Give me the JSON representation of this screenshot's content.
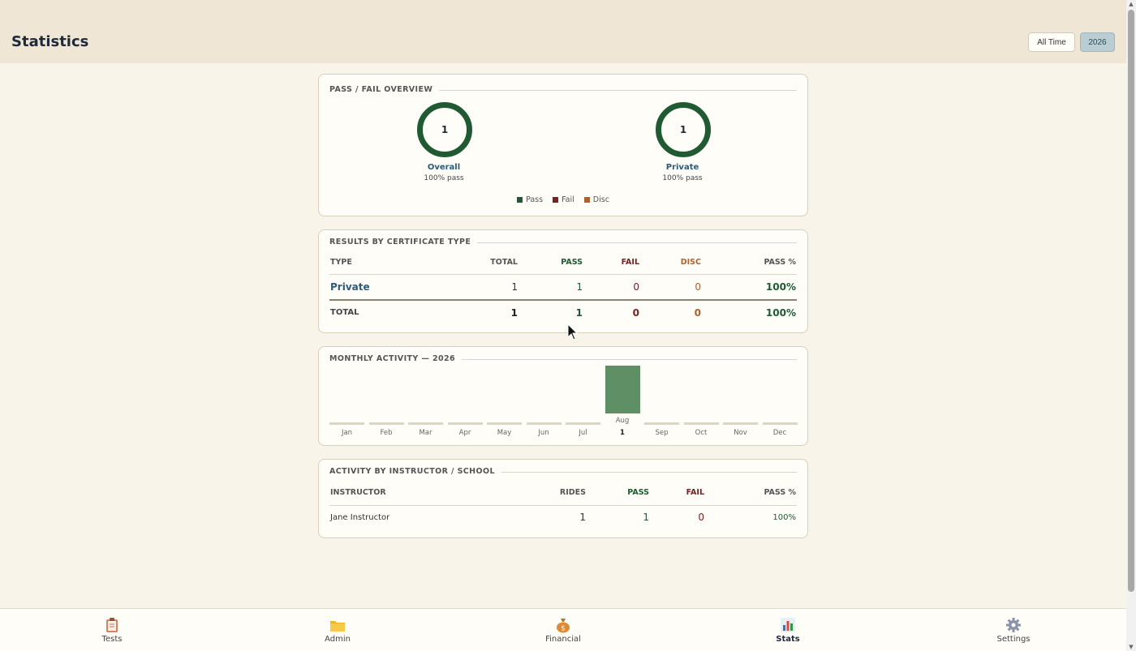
{
  "header": {
    "title": "Statistics",
    "range_all": "All Time",
    "range_year": "2026"
  },
  "overview": {
    "title": "PASS / FAIL OVERVIEW",
    "donuts": [
      {
        "value": "1",
        "label": "Overall",
        "sub": "100% pass"
      },
      {
        "value": "1",
        "label": "Private",
        "sub": "100% pass"
      }
    ],
    "legend": [
      {
        "label": "Pass",
        "color": "#1f5a32"
      },
      {
        "label": "Fail",
        "color": "#7a2020"
      },
      {
        "label": "Disc",
        "color": "#b0602a"
      }
    ]
  },
  "results": {
    "title": "RESULTS BY CERTIFICATE TYPE",
    "headers": [
      "TYPE",
      "TOTAL",
      "PASS",
      "FAIL",
      "DISC",
      "PASS %"
    ],
    "rows": [
      {
        "type": "Private",
        "total": "1",
        "pass": "1",
        "fail": "0",
        "disc": "0",
        "pct": "100%"
      }
    ],
    "totals": {
      "type": "TOTAL",
      "total": "1",
      "pass": "1",
      "fail": "0",
      "disc": "0",
      "pct": "100%"
    }
  },
  "monthly": {
    "title": "MONTHLY ACTIVITY — 2026",
    "months": [
      "Jan",
      "Feb",
      "Mar",
      "Apr",
      "May",
      "Jun",
      "Jul",
      "Aug",
      "Sep",
      "Oct",
      "Nov",
      "Dec"
    ],
    "counts": [
      0,
      0,
      0,
      0,
      0,
      0,
      0,
      1,
      0,
      0,
      0,
      0
    ],
    "active_count_label": "1"
  },
  "instructors": {
    "title": "ACTIVITY BY INSTRUCTOR / SCHOOL",
    "headers": [
      "INSTRUCTOR",
      "RIDES",
      "PASS",
      "FAIL",
      "PASS %"
    ],
    "rows": [
      {
        "name": "Jane Instructor",
        "rides": "1",
        "pass": "1",
        "fail": "0",
        "pct": "100%"
      }
    ]
  },
  "nav": [
    {
      "label": "Tests",
      "icon": "clipboard-icon"
    },
    {
      "label": "Admin",
      "icon": "folder-icon"
    },
    {
      "label": "Financial",
      "icon": "money-bag-icon"
    },
    {
      "label": "Stats",
      "icon": "bar-chart-icon"
    },
    {
      "label": "Settings",
      "icon": "gear-icon"
    }
  ],
  "colors": {
    "pass": "#1f5a32",
    "fail": "#7a2020",
    "disc": "#b0602a",
    "link": "#2d5a78"
  }
}
